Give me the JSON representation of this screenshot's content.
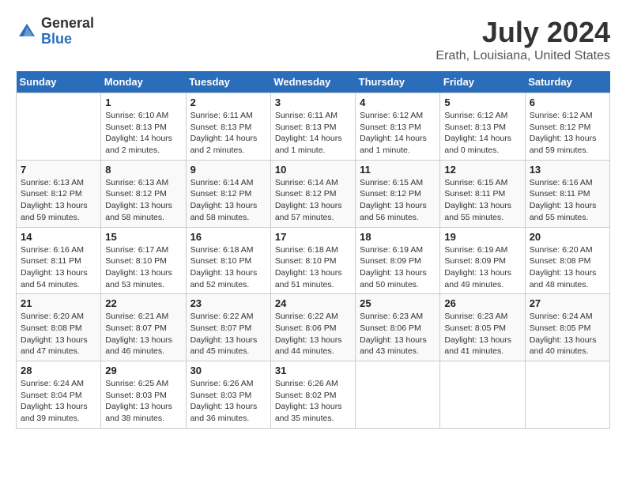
{
  "header": {
    "logo_general": "General",
    "logo_blue": "Blue",
    "title": "July 2024",
    "subtitle": "Erath, Louisiana, United States"
  },
  "calendar": {
    "days_of_week": [
      "Sunday",
      "Monday",
      "Tuesday",
      "Wednesday",
      "Thursday",
      "Friday",
      "Saturday"
    ],
    "weeks": [
      [
        {
          "day": "",
          "info": ""
        },
        {
          "day": "1",
          "info": "Sunrise: 6:10 AM\nSunset: 8:13 PM\nDaylight: 14 hours\nand 2 minutes."
        },
        {
          "day": "2",
          "info": "Sunrise: 6:11 AM\nSunset: 8:13 PM\nDaylight: 14 hours\nand 2 minutes."
        },
        {
          "day": "3",
          "info": "Sunrise: 6:11 AM\nSunset: 8:13 PM\nDaylight: 14 hours\nand 1 minute."
        },
        {
          "day": "4",
          "info": "Sunrise: 6:12 AM\nSunset: 8:13 PM\nDaylight: 14 hours\nand 1 minute."
        },
        {
          "day": "5",
          "info": "Sunrise: 6:12 AM\nSunset: 8:13 PM\nDaylight: 14 hours\nand 0 minutes."
        },
        {
          "day": "6",
          "info": "Sunrise: 6:12 AM\nSunset: 8:12 PM\nDaylight: 13 hours\nand 59 minutes."
        }
      ],
      [
        {
          "day": "7",
          "info": "Sunrise: 6:13 AM\nSunset: 8:12 PM\nDaylight: 13 hours\nand 59 minutes."
        },
        {
          "day": "8",
          "info": "Sunrise: 6:13 AM\nSunset: 8:12 PM\nDaylight: 13 hours\nand 58 minutes."
        },
        {
          "day": "9",
          "info": "Sunrise: 6:14 AM\nSunset: 8:12 PM\nDaylight: 13 hours\nand 58 minutes."
        },
        {
          "day": "10",
          "info": "Sunrise: 6:14 AM\nSunset: 8:12 PM\nDaylight: 13 hours\nand 57 minutes."
        },
        {
          "day": "11",
          "info": "Sunrise: 6:15 AM\nSunset: 8:12 PM\nDaylight: 13 hours\nand 56 minutes."
        },
        {
          "day": "12",
          "info": "Sunrise: 6:15 AM\nSunset: 8:11 PM\nDaylight: 13 hours\nand 55 minutes."
        },
        {
          "day": "13",
          "info": "Sunrise: 6:16 AM\nSunset: 8:11 PM\nDaylight: 13 hours\nand 55 minutes."
        }
      ],
      [
        {
          "day": "14",
          "info": "Sunrise: 6:16 AM\nSunset: 8:11 PM\nDaylight: 13 hours\nand 54 minutes."
        },
        {
          "day": "15",
          "info": "Sunrise: 6:17 AM\nSunset: 8:10 PM\nDaylight: 13 hours\nand 53 minutes."
        },
        {
          "day": "16",
          "info": "Sunrise: 6:18 AM\nSunset: 8:10 PM\nDaylight: 13 hours\nand 52 minutes."
        },
        {
          "day": "17",
          "info": "Sunrise: 6:18 AM\nSunset: 8:10 PM\nDaylight: 13 hours\nand 51 minutes."
        },
        {
          "day": "18",
          "info": "Sunrise: 6:19 AM\nSunset: 8:09 PM\nDaylight: 13 hours\nand 50 minutes."
        },
        {
          "day": "19",
          "info": "Sunrise: 6:19 AM\nSunset: 8:09 PM\nDaylight: 13 hours\nand 49 minutes."
        },
        {
          "day": "20",
          "info": "Sunrise: 6:20 AM\nSunset: 8:08 PM\nDaylight: 13 hours\nand 48 minutes."
        }
      ],
      [
        {
          "day": "21",
          "info": "Sunrise: 6:20 AM\nSunset: 8:08 PM\nDaylight: 13 hours\nand 47 minutes."
        },
        {
          "day": "22",
          "info": "Sunrise: 6:21 AM\nSunset: 8:07 PM\nDaylight: 13 hours\nand 46 minutes."
        },
        {
          "day": "23",
          "info": "Sunrise: 6:22 AM\nSunset: 8:07 PM\nDaylight: 13 hours\nand 45 minutes."
        },
        {
          "day": "24",
          "info": "Sunrise: 6:22 AM\nSunset: 8:06 PM\nDaylight: 13 hours\nand 44 minutes."
        },
        {
          "day": "25",
          "info": "Sunrise: 6:23 AM\nSunset: 8:06 PM\nDaylight: 13 hours\nand 43 minutes."
        },
        {
          "day": "26",
          "info": "Sunrise: 6:23 AM\nSunset: 8:05 PM\nDaylight: 13 hours\nand 41 minutes."
        },
        {
          "day": "27",
          "info": "Sunrise: 6:24 AM\nSunset: 8:05 PM\nDaylight: 13 hours\nand 40 minutes."
        }
      ],
      [
        {
          "day": "28",
          "info": "Sunrise: 6:24 AM\nSunset: 8:04 PM\nDaylight: 13 hours\nand 39 minutes."
        },
        {
          "day": "29",
          "info": "Sunrise: 6:25 AM\nSunset: 8:03 PM\nDaylight: 13 hours\nand 38 minutes."
        },
        {
          "day": "30",
          "info": "Sunrise: 6:26 AM\nSunset: 8:03 PM\nDaylight: 13 hours\nand 36 minutes."
        },
        {
          "day": "31",
          "info": "Sunrise: 6:26 AM\nSunset: 8:02 PM\nDaylight: 13 hours\nand 35 minutes."
        },
        {
          "day": "",
          "info": ""
        },
        {
          "day": "",
          "info": ""
        },
        {
          "day": "",
          "info": ""
        }
      ]
    ]
  }
}
